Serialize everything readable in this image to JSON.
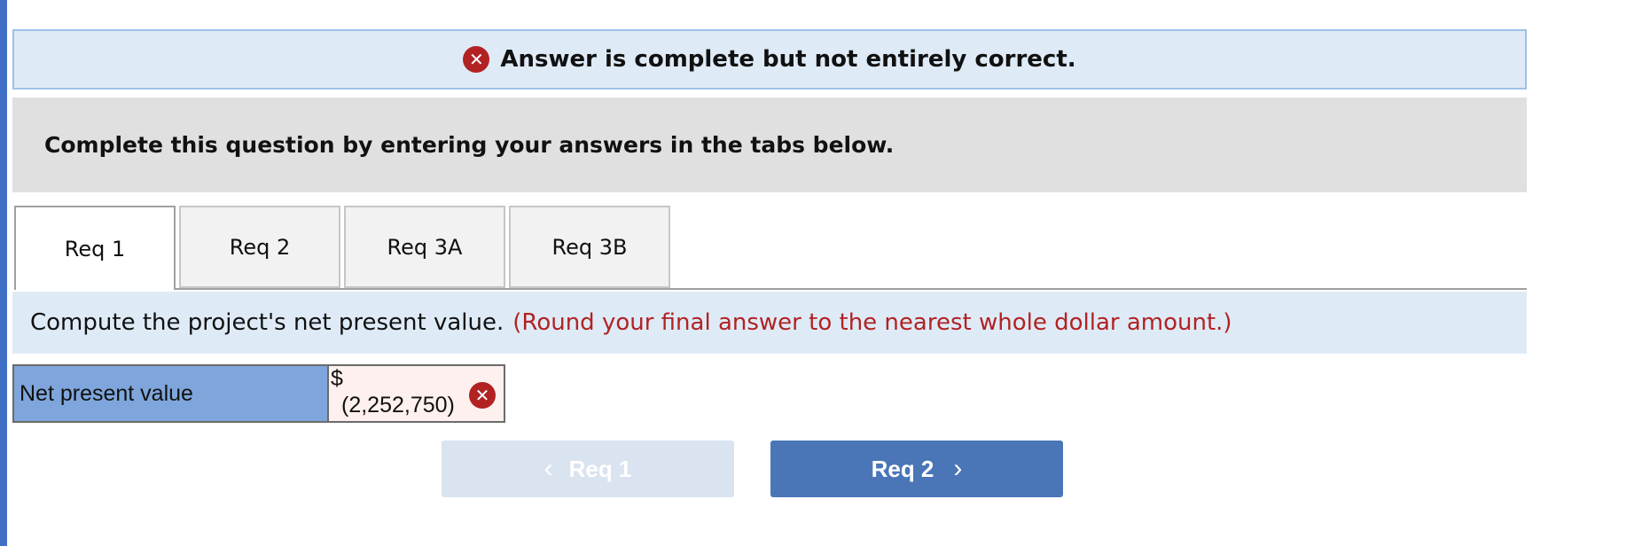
{
  "banner": {
    "status_icon": "x-circle-icon",
    "status_icon_glyph": "✕",
    "message": "Answer is complete but not entirely correct.",
    "status_color": "#b22222"
  },
  "instructions": {
    "text": "Complete this question by entering your answers in the tabs below."
  },
  "tabs": [
    {
      "label": "Req 1",
      "active": true
    },
    {
      "label": "Req 2",
      "active": false
    },
    {
      "label": "Req 3A",
      "active": false
    },
    {
      "label": "Req 3B",
      "active": false
    }
  ],
  "prompt": {
    "main": "Compute the project's net present value.",
    "note": "(Round your final answer to the nearest whole dollar amount.)"
  },
  "answer": {
    "label": "Net present value",
    "currency": "$",
    "value": "(2,252,750)",
    "result_icon": "x-circle-icon",
    "result_icon_glyph": "✕"
  },
  "navigation": {
    "prev_label": "Req 1",
    "prev_icon": "chevron-left-icon",
    "prev_glyph": "‹",
    "next_label": "Req 2",
    "next_icon": "chevron-right-icon",
    "next_glyph": "›"
  },
  "colors": {
    "accent": "#4a76b8",
    "banner_bg": "#deebf7",
    "error": "#b22222",
    "label_bg": "#7fa6dc"
  }
}
